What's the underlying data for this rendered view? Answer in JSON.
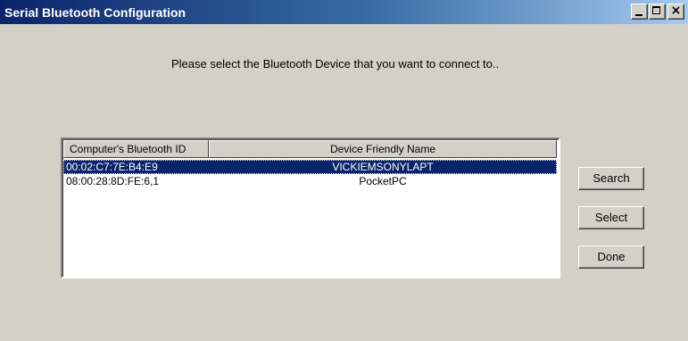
{
  "window": {
    "title": "Serial Bluetooth Configuration",
    "titlebar_colors": [
      "#0a246a",
      "#a6caf0"
    ],
    "controls": {
      "minimize_icon": "minimize-icon",
      "maximize_icon": "maximize-icon",
      "close_icon": "close-icon",
      "close_glyph": "×"
    }
  },
  "prompt": "Please select the Bluetooth Device that you want to connect to..",
  "device_list": {
    "columns": [
      "Computer's Bluetooth ID",
      "Device Friendly Name"
    ],
    "rows": [
      {
        "id": "00:02:C7:7E:B4:E9",
        "name": "VICKIEMSONYLAPT",
        "selected": true
      },
      {
        "id": "08:00:28:8D:FE:6,1",
        "name": "PocketPC",
        "selected": false
      }
    ],
    "selection_color": "#0a246a"
  },
  "buttons": {
    "search": "Search",
    "select": "Select",
    "done": "Done"
  }
}
